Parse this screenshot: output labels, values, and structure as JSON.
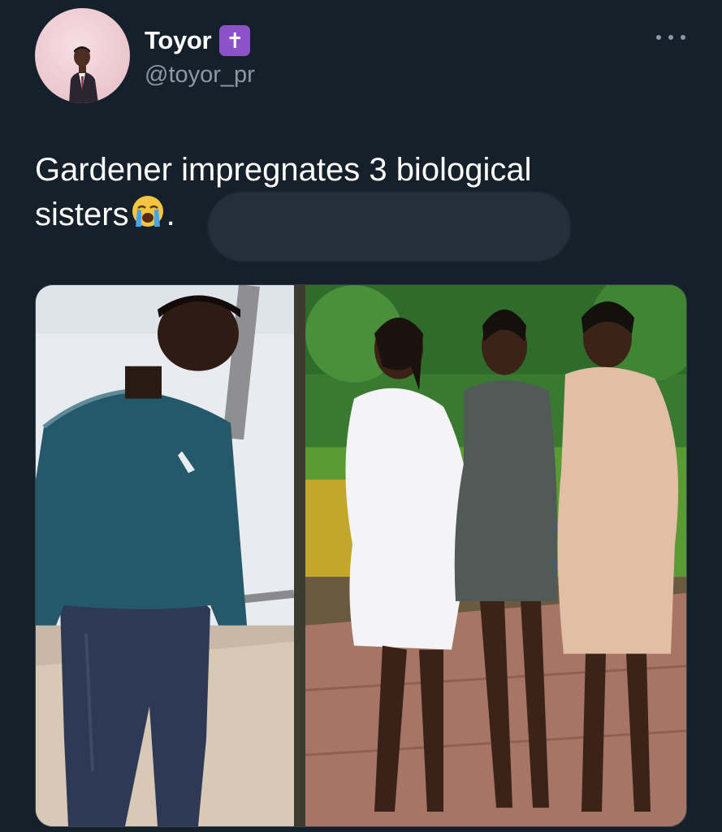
{
  "author": {
    "display_name": "Toyor",
    "badge_icon": "latin-cross-icon",
    "badge_glyph": "✝",
    "badge_color": "#8b52c9",
    "handle": "@toyor_pr",
    "avatar": "profile-photo-man-in-suit"
  },
  "tweet": {
    "text_line1": "Gardener impregnates 3 biological",
    "text_line2": "sisters",
    "emoji": "loudly-crying-face-emoji",
    "trailing_punct": ".",
    "redacted": true
  },
  "media": {
    "left_image": "photo-young-man-green-sweatshirt",
    "right_image": "photo-three-women-in-dresses-garden"
  },
  "colors": {
    "background": "#15202b",
    "text_primary": "#ffffff",
    "text_secondary": "#8b98a5"
  },
  "icons": {
    "more": "more-options-icon"
  }
}
